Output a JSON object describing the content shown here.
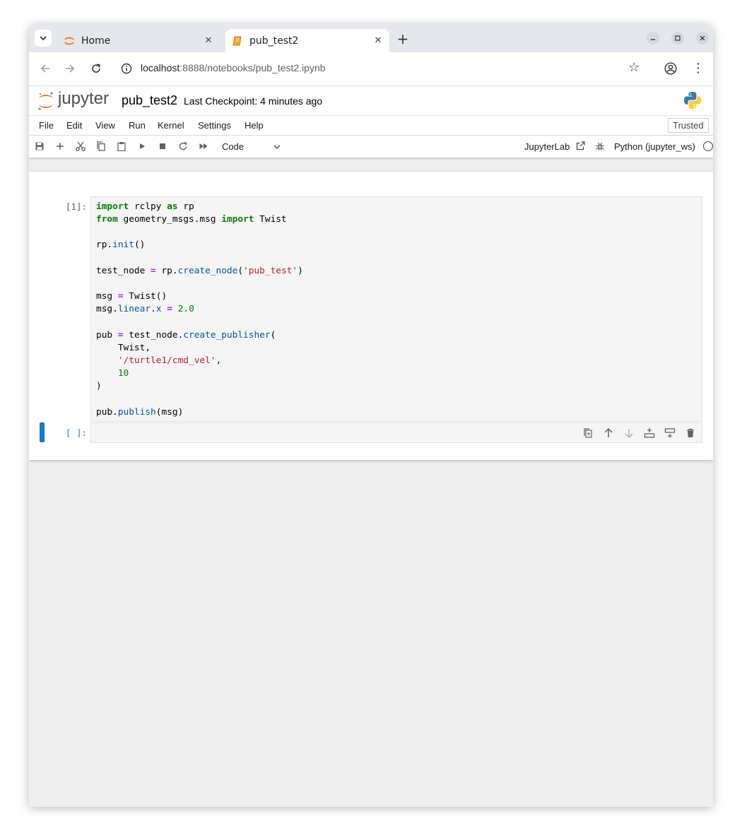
{
  "browser": {
    "tabs": [
      {
        "title": "Home",
        "active": false
      },
      {
        "title": "pub_test2",
        "active": true
      }
    ],
    "url": {
      "host": "localhost",
      "rest": ":8888/notebooks/pub_test2.ipynb"
    },
    "icons": [
      "tab-search-icon",
      "jupyter-favicon-icon",
      "notebook-favicon-icon",
      "close-icon",
      "plus-icon",
      "minimize-icon",
      "maximize-icon",
      "close-window-icon",
      "back-icon",
      "forward-icon",
      "reload-icon",
      "info-icon",
      "star-icon",
      "profile-icon",
      "more-vert-icon"
    ]
  },
  "jupyter": {
    "logo_text": "jupyter",
    "notebook_name": "pub_test2",
    "checkpoint": "Last Checkpoint: 4 minutes ago",
    "menu": [
      "File",
      "Edit",
      "View",
      "Run",
      "Kernel",
      "Settings",
      "Help"
    ],
    "trusted": "Trusted",
    "toolbar": {
      "cell_type": "Code",
      "open_in_lab": "JupyterLab",
      "kernel": "Python (jupyter_ws)"
    }
  },
  "cells": [
    {
      "prompt": "[1]:",
      "source": [
        "import rclpy as rp",
        "from geometry_msgs.msg import Twist",
        "",
        "rp.init()",
        "",
        "test_node = rp.create_node('pub_test')",
        "",
        "msg = Twist()",
        "msg.linear.x = 2.0",
        "",
        "pub = test_node.create_publisher(",
        "    Twist,",
        "    '/turtle1/cmd_vel',",
        "    10",
        ")",
        "",
        "pub.publish(msg)"
      ]
    },
    {
      "prompt": "[ ]:",
      "source": []
    }
  ],
  "colors": {
    "accent_active_cell": "#1976d2",
    "keyword": "#008000",
    "operator": "#aa22ff",
    "property": "#0055aa",
    "string": "#ba2121",
    "jupyter_orange": "#f37726"
  }
}
